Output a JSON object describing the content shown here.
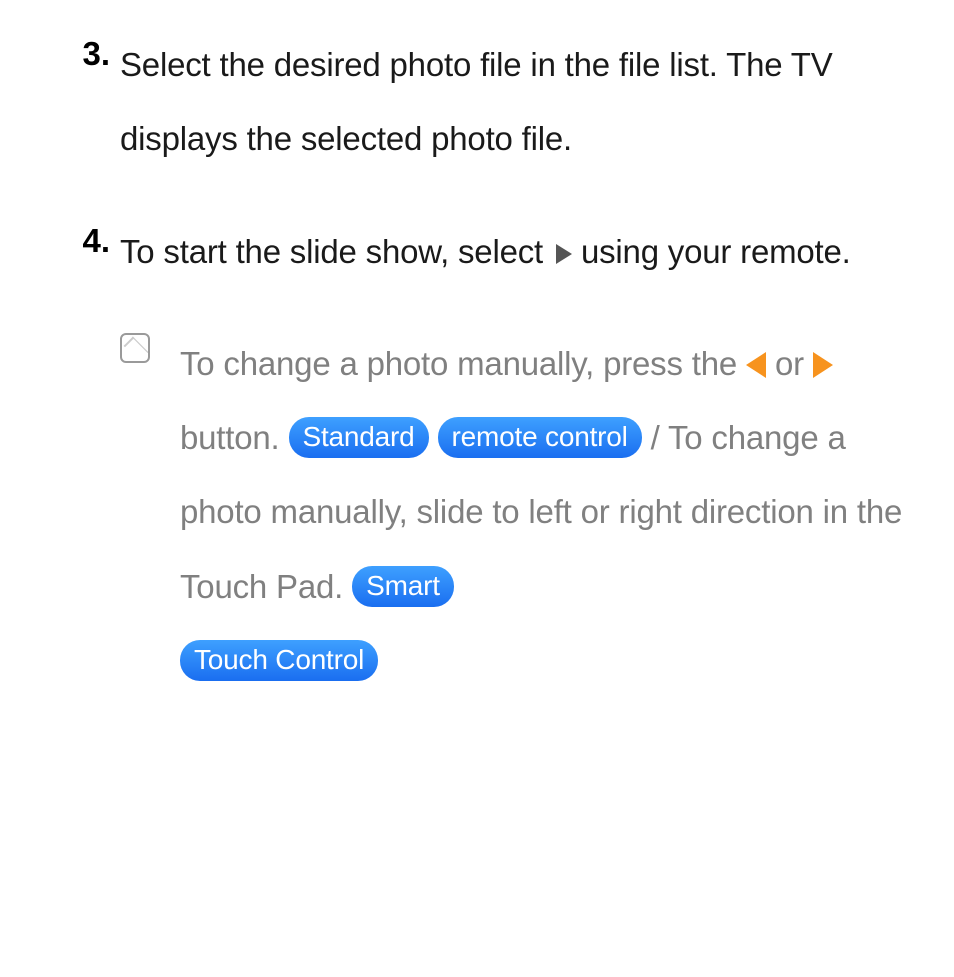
{
  "steps": {
    "s3": {
      "num": "3.",
      "text": "Select the desired photo file in the file list. The TV displays the selected photo file."
    },
    "s4": {
      "num": "4.",
      "text_a": "To start the slide show, select ",
      "text_b": " using your remote."
    }
  },
  "note": {
    "p1a": "To change a photo manually, press the ",
    "p1b": " or ",
    "p1c": " button. ",
    "pill1a": "Standard",
    "pill1b": "remote control",
    "p2a": " / To change a photo manually, slide to left or right direction in the Touch Pad. ",
    "pill2a": "Smart",
    "pill2b": "Touch Control"
  }
}
